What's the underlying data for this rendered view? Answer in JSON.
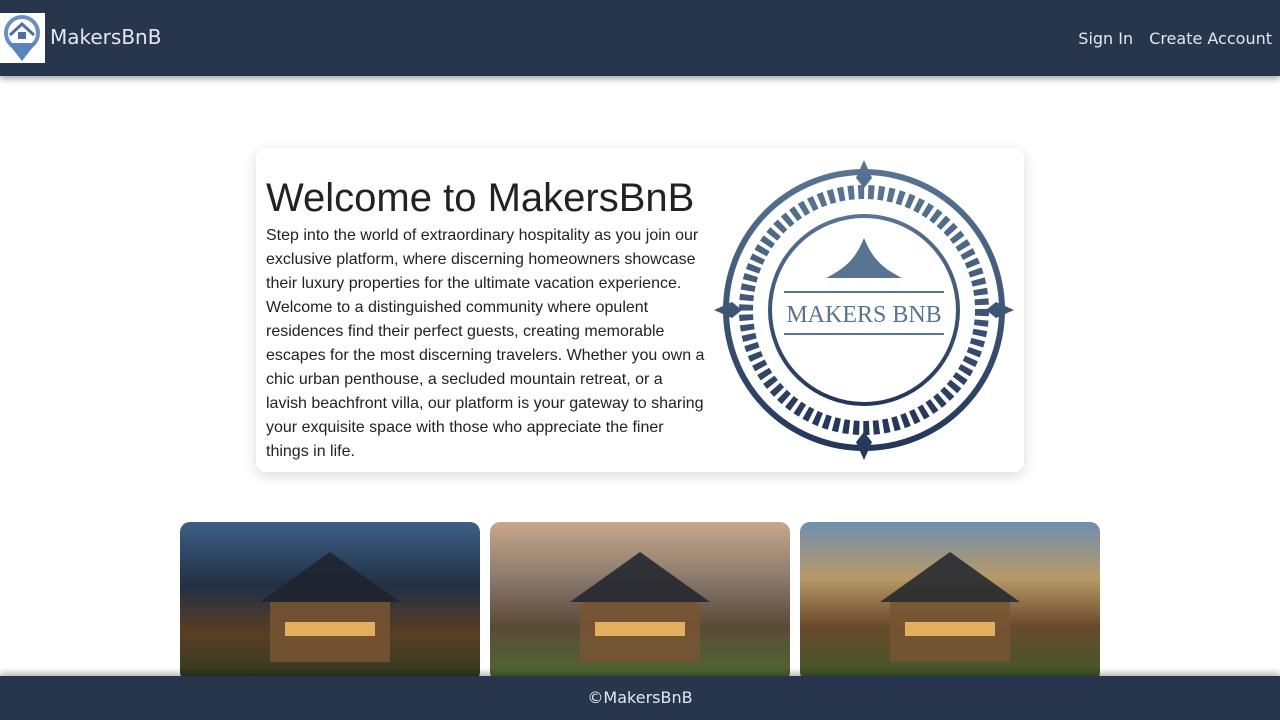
{
  "nav": {
    "brand": "MakersBnB",
    "sign_in": "Sign In",
    "create_account": "Create Account"
  },
  "welcome": {
    "title": "Welcome to MakersBnB",
    "body": "Step into the world of extraordinary hospitality as you join our exclusive platform, where discerning homeowners showcase their luxury properties for the ultimate vacation experience. Welcome to a distinguished community where opulent residences find their perfect guests, creating memorable escapes for the most discerning travelers. Whether you own a chic urban penthouse, a secluded mountain retreat, or a lavish beachfront villa, our platform is your gateway to sharing your exquisite space with those who appreciate the finer things in life.",
    "emblem_text": "Makers BnB"
  },
  "footer": {
    "text": "©MakersBnB"
  },
  "colors": {
    "navbar": "#27364d",
    "emblem": "#4e6a86"
  }
}
